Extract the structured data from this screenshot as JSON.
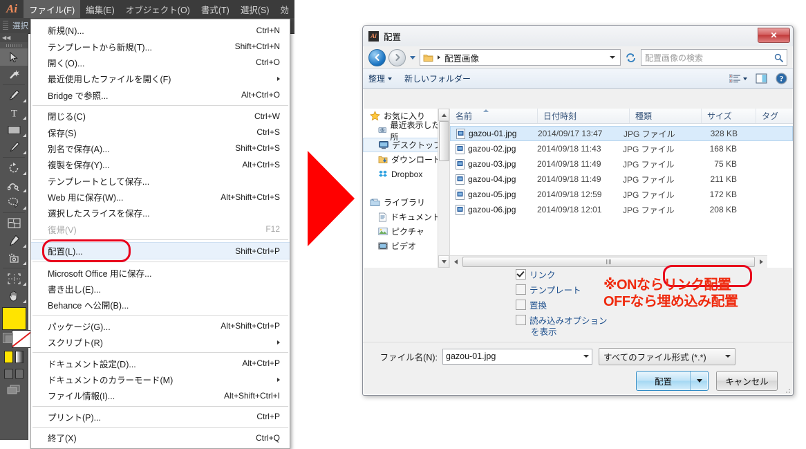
{
  "app": {
    "logo": "Ai",
    "menubar": [
      {
        "label": "ファイル(F)",
        "active": true
      },
      {
        "label": "編集(E)",
        "active": false
      },
      {
        "label": "オブジェクト(O)",
        "active": false
      },
      {
        "label": "書式(T)",
        "active": false
      },
      {
        "label": "選択(S)",
        "active": false
      },
      {
        "label": "効",
        "active": false
      }
    ],
    "control_bar_label": "選択"
  },
  "file_menu": {
    "items": [
      {
        "label": "新規(N)...",
        "shortcut": "Ctrl+N",
        "type": "item"
      },
      {
        "label": "テンプレートから新規(T)...",
        "shortcut": "Shift+Ctrl+N",
        "type": "item"
      },
      {
        "label": "開く(O)...",
        "shortcut": "Ctrl+O",
        "type": "item"
      },
      {
        "label": "最近使用したファイルを開く(F)",
        "shortcut": "",
        "type": "submenu"
      },
      {
        "label": "Bridge で参照...",
        "shortcut": "Alt+Ctrl+O",
        "type": "item"
      },
      {
        "type": "separator"
      },
      {
        "label": "閉じる(C)",
        "shortcut": "Ctrl+W",
        "type": "item"
      },
      {
        "label": "保存(S)",
        "shortcut": "Ctrl+S",
        "type": "item"
      },
      {
        "label": "別名で保存(A)...",
        "shortcut": "Shift+Ctrl+S",
        "type": "item"
      },
      {
        "label": "複製を保存(Y)...",
        "shortcut": "Alt+Ctrl+S",
        "type": "item"
      },
      {
        "label": "テンプレートとして保存...",
        "shortcut": "",
        "type": "item"
      },
      {
        "label": "Web 用に保存(W)...",
        "shortcut": "Alt+Shift+Ctrl+S",
        "type": "item"
      },
      {
        "label": "選択したスライスを保存...",
        "shortcut": "",
        "type": "item"
      },
      {
        "label": "復帰(V)",
        "shortcut": "F12",
        "type": "disabled"
      },
      {
        "type": "separator"
      },
      {
        "label": "配置(L)...",
        "shortcut": "Shift+Ctrl+P",
        "type": "highlighted"
      },
      {
        "type": "separator"
      },
      {
        "label": "Microsoft Office 用に保存...",
        "shortcut": "",
        "type": "item"
      },
      {
        "label": "書き出し(E)...",
        "shortcut": "",
        "type": "item"
      },
      {
        "label": "Behance へ公開(B)...",
        "shortcut": "",
        "type": "item"
      },
      {
        "type": "separator"
      },
      {
        "label": "パッケージ(G)...",
        "shortcut": "Alt+Shift+Ctrl+P",
        "type": "item"
      },
      {
        "label": "スクリプト(R)",
        "shortcut": "",
        "type": "submenu"
      },
      {
        "type": "separator"
      },
      {
        "label": "ドキュメント設定(D)...",
        "shortcut": "Alt+Ctrl+P",
        "type": "item"
      },
      {
        "label": "ドキュメントのカラーモード(M)",
        "shortcut": "",
        "type": "submenu"
      },
      {
        "label": "ファイル情報(I)...",
        "shortcut": "Alt+Shift+Ctrl+I",
        "type": "item"
      },
      {
        "type": "separator"
      },
      {
        "label": "プリント(P)...",
        "shortcut": "Ctrl+P",
        "type": "item"
      },
      {
        "type": "separator"
      },
      {
        "label": "終了(X)",
        "shortcut": "Ctrl+Q",
        "type": "item"
      }
    ]
  },
  "dialog": {
    "title": "配置",
    "address": {
      "folder": "配置画像"
    },
    "search_placeholder": "配置画像の検索",
    "toolbar": {
      "organize": "整理",
      "new_folder": "新しいフォルダー"
    },
    "nav_pane": [
      {
        "label": "お気に入り",
        "icon": "star-icon",
        "level": "root",
        "selected": false
      },
      {
        "label": "最近表示した場所",
        "icon": "recent-places-icon",
        "level": "child",
        "selected": false
      },
      {
        "label": "デスクトップ",
        "icon": "desktop-icon",
        "level": "child",
        "selected": true
      },
      {
        "label": "ダウンロード",
        "icon": "downloads-icon",
        "level": "child",
        "selected": false
      },
      {
        "label": "Dropbox",
        "icon": "dropbox-icon",
        "level": "child",
        "selected": false
      },
      {
        "label": "ライブラリ",
        "icon": "library-icon",
        "level": "root",
        "selected": false
      },
      {
        "label": "ドキュメント",
        "icon": "documents-icon",
        "level": "child",
        "selected": false
      },
      {
        "label": "ピクチャ",
        "icon": "pictures-icon",
        "level": "child",
        "selected": false
      },
      {
        "label": "ビデオ",
        "icon": "videos-icon",
        "level": "child",
        "selected": false
      }
    ],
    "columns": [
      "名前",
      "日付時刻",
      "種類",
      "サイズ",
      "タグ"
    ],
    "files": [
      {
        "name": "gazou-01.jpg",
        "date": "2014/09/17 13:47",
        "type": "JPG ファイル",
        "size": "328 KB",
        "selected": true
      },
      {
        "name": "gazou-02.jpg",
        "date": "2014/09/18 11:43",
        "type": "JPG ファイル",
        "size": "168 KB",
        "selected": false
      },
      {
        "name": "gazou-03.jpg",
        "date": "2014/09/18 11:49",
        "type": "JPG ファイル",
        "size": "75 KB",
        "selected": false
      },
      {
        "name": "gazou-04.jpg",
        "date": "2014/09/18 11:49",
        "type": "JPG ファイル",
        "size": "211 KB",
        "selected": false
      },
      {
        "name": "gazou-05.jpg",
        "date": "2014/09/18 12:59",
        "type": "JPG ファイル",
        "size": "172 KB",
        "selected": false
      },
      {
        "name": "gazou-06.jpg",
        "date": "2014/09/18 12:01",
        "type": "JPG ファイル",
        "size": "208 KB",
        "selected": false
      }
    ],
    "options": [
      {
        "label": "リンク",
        "checked": true
      },
      {
        "label": "テンプレート",
        "checked": false
      },
      {
        "label": "置換",
        "checked": false
      },
      {
        "label": "読み込みオプション",
        "checked": false
      }
    ],
    "option_continuation": "を表示",
    "filename_label": "ファイル名(N):",
    "filename_value": "gazou-01.jpg",
    "filter_value": "すべてのファイル形式 (*.*)",
    "place_button": "配置",
    "cancel_button": "キャンセル"
  },
  "annotation": {
    "line1": "※ONならリンク配置",
    "line2": "OFFなら埋め込み配置",
    "color": "#EF2A0E",
    "highlight_color": "#E8001B",
    "arrow_color": "#FF0000"
  }
}
